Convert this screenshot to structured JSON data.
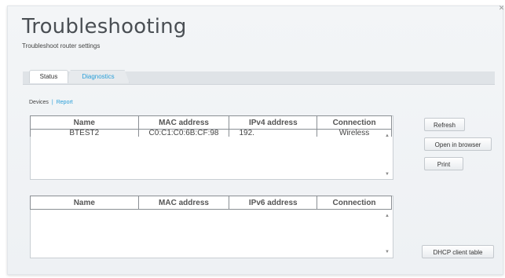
{
  "page": {
    "title": "Troubleshooting",
    "subtitle": "Troubleshoot router settings",
    "close_icon": "✕"
  },
  "tabs": [
    {
      "label": "Status",
      "active": true
    },
    {
      "label": "Diagnostics",
      "active": false
    }
  ],
  "subnav": {
    "devices": "Devices",
    "separator": "|",
    "report": "Report"
  },
  "ipv4_table": {
    "headers": [
      "Name",
      "MAC address",
      "IPv4 address",
      "Connection"
    ],
    "rows": [
      {
        "name": "BTEST2",
        "mac": "C0:C1:C0:6B:CF:98",
        "ip": "192.",
        "connection": "Wireless"
      }
    ]
  },
  "ipv6_table": {
    "headers": [
      "Name",
      "MAC address",
      "IPv6 address",
      "Connection"
    ],
    "rows": []
  },
  "buttons": {
    "refresh": "Refresh",
    "open_in_browser": "Open in browser",
    "print": "Print",
    "dhcp_client_table": "DHCP client table"
  },
  "colors": {
    "accent": "#2a9fd8",
    "panel_bg": "#f1f3f6"
  }
}
